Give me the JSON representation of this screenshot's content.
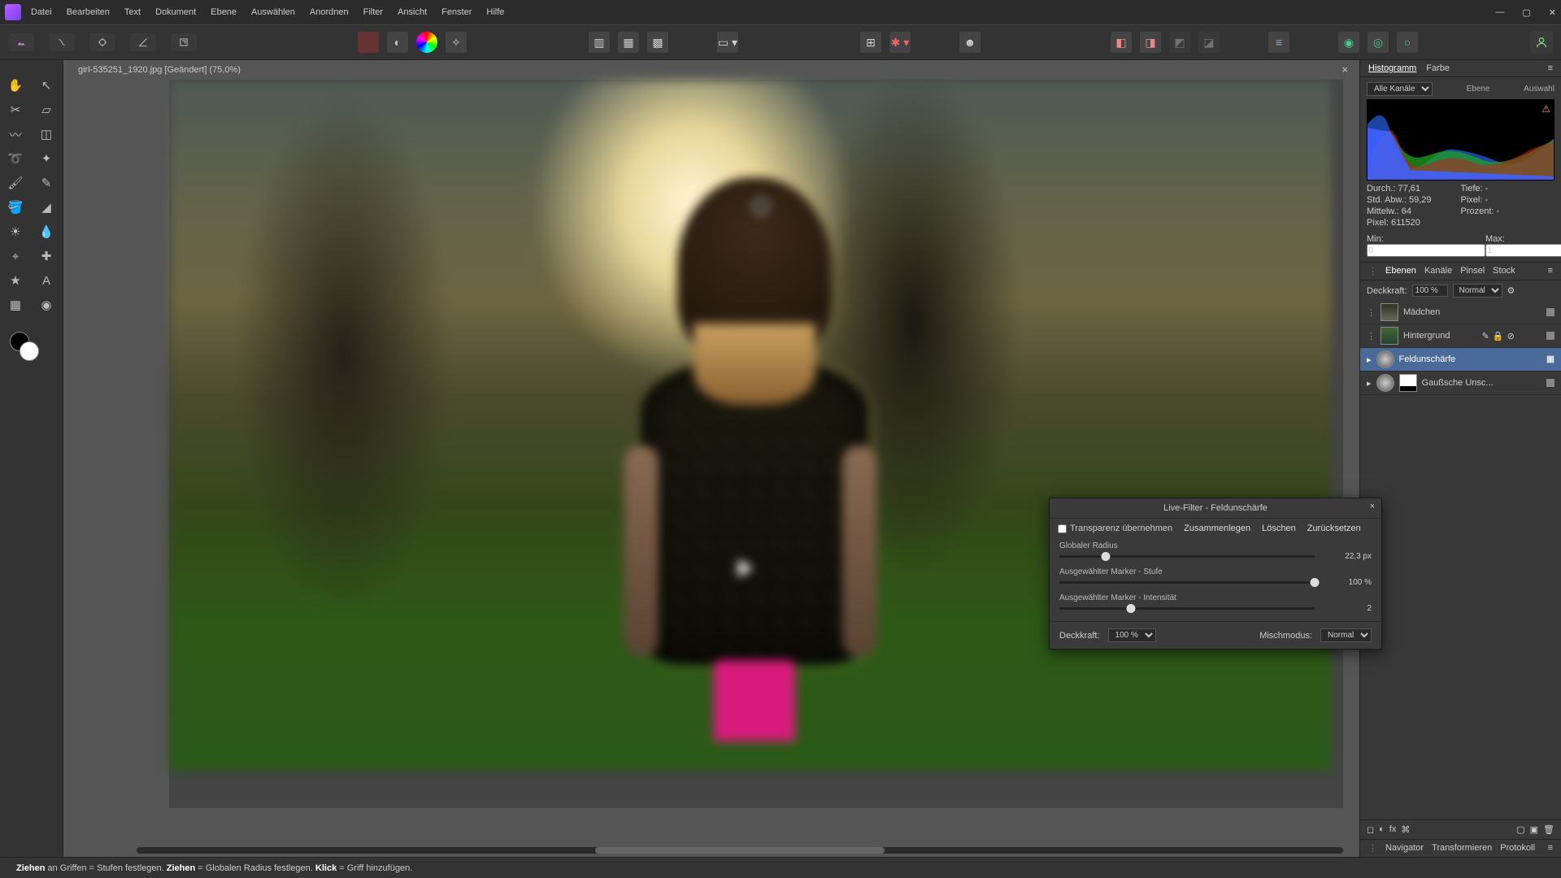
{
  "menu": [
    "Datei",
    "Bearbeiten",
    "Text",
    "Dokument",
    "Ebene",
    "Auswählen",
    "Anordnen",
    "Filter",
    "Ansicht",
    "Fenster",
    "Hilfe"
  ],
  "doc": {
    "tab": "girl-535251_1920.jpg [Geändert] (75,0%)"
  },
  "histogram": {
    "tabs": [
      "Histogramm",
      "Farbe"
    ],
    "channel": "Alle Kanäle",
    "btn_ebene": "Ebene",
    "btn_auswahl": "Auswahl",
    "stats": {
      "durch": "Durch.: 77,61",
      "tiefe": "Tiefe: -",
      "stdabw": "Std. Abw.: 59,29",
      "pixel2": "Pixel: -",
      "mittelw": "Mittelw.: 64",
      "prozent": "Prozent: -",
      "pixel": "Pixel: 611520"
    },
    "min_lbl": "Min:",
    "min": "0",
    "max_lbl": "Max:",
    "max": "1"
  },
  "layers_panel": {
    "tabs": [
      "Ebenen",
      "Kanäle",
      "Pinsel",
      "Stock"
    ],
    "opacity_lbl": "Deckkraft:",
    "opacity": "100 %",
    "blend": "Normal",
    "rows": [
      {
        "name": "Mädchen",
        "sel": false,
        "vis": true
      },
      {
        "name": "Hintergrund",
        "sel": false,
        "vis": true,
        "edit": true
      },
      {
        "name": "Feldunschärfe",
        "sel": true,
        "vis": true
      },
      {
        "name": "Gaußsche Unsc...",
        "sel": false,
        "vis": true,
        "mask": true
      }
    ]
  },
  "bottom_tabs": [
    "Navigator",
    "Transformieren",
    "Protokoll"
  ],
  "dialog": {
    "title": "Live-Filter - Feldunschärfe",
    "transp": "Transparenz übernehmen",
    "merge": "Zusammenlegen",
    "delete": "Löschen",
    "reset": "Zurücksetzen",
    "sliders": [
      {
        "label": "Globaler Radius",
        "value": "22,3 px",
        "pos": 18
      },
      {
        "label": "Ausgewählter Marker - Stufe",
        "value": "100 %",
        "pos": 100
      },
      {
        "label": "Ausgewählter Marker - Intensität",
        "value": "2",
        "pos": 28
      }
    ],
    "opacity_lbl": "Deckkraft:",
    "opacity": "100 %",
    "blend_lbl": "Mischmodus:",
    "blend": "Normal"
  },
  "status": {
    "t1": "Ziehen",
    "s1": " an Griffen = Stufen festlegen. ",
    "t2": "Ziehen",
    "s2": " = Globalen Radius festlegen. ",
    "t3": "Klick",
    "s3": " = Griff hinzufügen."
  },
  "icons": {
    "tools": [
      "hand",
      "arrow",
      "crop",
      "rotate",
      "lasso",
      "wand",
      "brush",
      "pencil",
      "stamp",
      "patch",
      "dodge",
      "drop",
      "heal",
      "sponge",
      "star",
      "text",
      "grid",
      "target"
    ]
  }
}
